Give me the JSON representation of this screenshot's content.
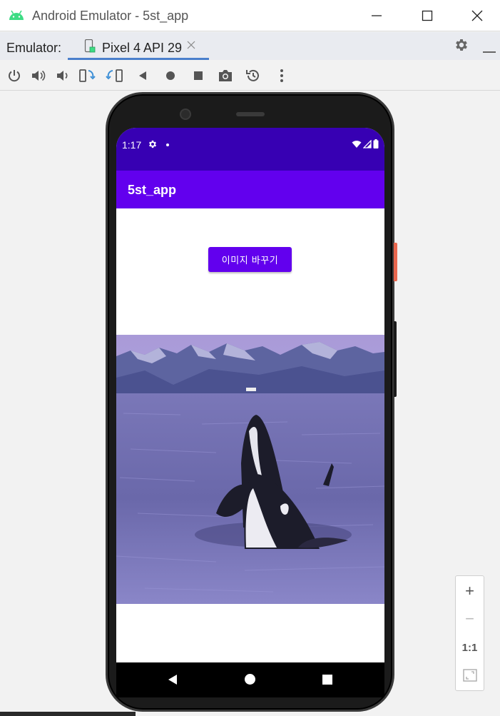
{
  "window": {
    "title": "Android Emulator - 5st_app",
    "icon": "android-icon",
    "controls": [
      "minimize-icon",
      "maximize-icon",
      "close-icon"
    ]
  },
  "tabbar": {
    "label": "Emulator:",
    "active_tab": "Pixel 4 API 29",
    "icons": [
      "device-icon",
      "close-tab-icon",
      "gear-icon",
      "minus-icon"
    ]
  },
  "toolbar": {
    "items": [
      "power-icon",
      "volume-up-icon",
      "volume-down-icon",
      "rotate-left-icon",
      "rotate-right-icon",
      "back-icon",
      "home-icon",
      "overview-icon",
      "screenshot-icon",
      "snapshot-icon",
      "more-icon"
    ]
  },
  "phone": {
    "status": {
      "time": "1:17",
      "icons": [
        "settings-icon",
        "dot-icon",
        "wifi-icon",
        "signal-icon",
        "battery-icon"
      ]
    },
    "app": {
      "title": "5st_app",
      "button_label": "이미지 바꾸기",
      "image": "orca-photo"
    },
    "nav": [
      "nav-back-icon",
      "nav-home-icon",
      "nav-recents-icon"
    ]
  },
  "zoom": {
    "plus": "+",
    "minus": "−",
    "one_to_one": "1:1",
    "fit_icon": "fit-screen-icon"
  },
  "colors": {
    "status_bar": "#3700b3",
    "app_bar": "#6200ee",
    "tab_underline": "#4a7fcc",
    "android_green": "#3ddc84"
  }
}
